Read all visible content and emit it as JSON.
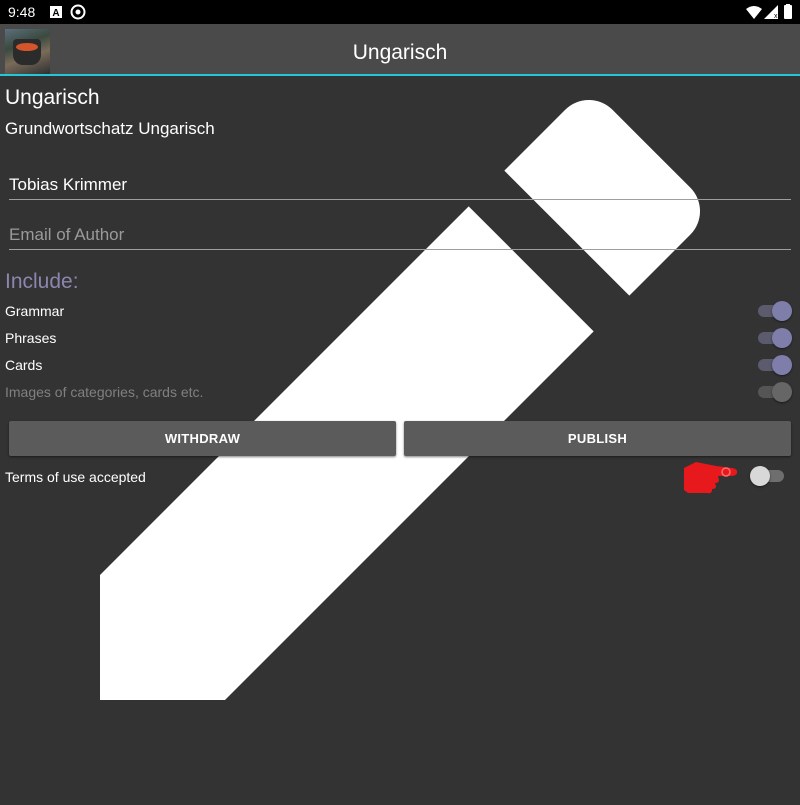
{
  "status_bar": {
    "time": "9:48",
    "left_icons": [
      "a-notification-icon",
      "blocked-circle-icon"
    ],
    "right_icons": [
      "wifi-icon",
      "signal-icon",
      "battery-icon"
    ]
  },
  "app_bar": {
    "title": "Ungarisch",
    "accent_color": "#26c6da",
    "edit_icon": "pencil-icon"
  },
  "course": {
    "title": "Ungarisch",
    "description": "Grundwortschatz Ungarisch"
  },
  "fields": {
    "author_name": {
      "value": "Tobias Krimmer",
      "placeholder": ""
    },
    "author_email": {
      "value": "",
      "placeholder": "Email of Author"
    }
  },
  "include": {
    "label": "Include:",
    "options": [
      {
        "label": "Grammar",
        "checked": true,
        "enabled": true
      },
      {
        "label": "Phrases",
        "checked": true,
        "enabled": true
      },
      {
        "label": "Cards",
        "checked": true,
        "enabled": true
      },
      {
        "label": "Images of categories, cards etc.",
        "checked": true,
        "enabled": false
      }
    ]
  },
  "buttons": {
    "withdraw": "WITHDRAW",
    "publish": "PUBLISH"
  },
  "terms": {
    "label": "Terms of use accepted",
    "checked": false,
    "hint_icon": "pointing-hand-icon",
    "hint_color": "#e8191c"
  }
}
